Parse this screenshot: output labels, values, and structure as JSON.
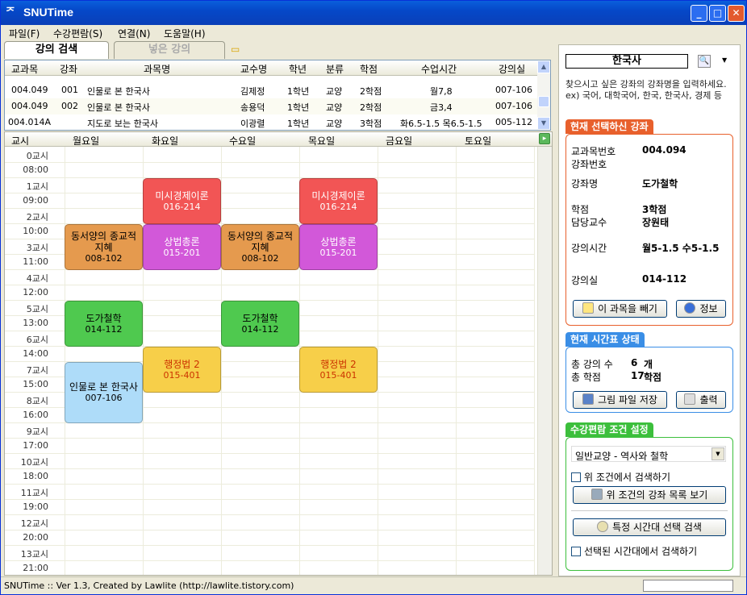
{
  "window": {
    "title": "SNUTime",
    "icon": "SNUTime-logo-icon"
  },
  "menu": [
    "파일(F)",
    "수강편람(S)",
    "연결(N)",
    "도움말(H)"
  ],
  "tabs": {
    "search": "강의 검색",
    "added": "넣은 강의"
  },
  "course_list": {
    "columns": [
      "교과목",
      "강좌",
      "과목명",
      "교수명",
      "학년",
      "분류",
      "학점",
      "수업시간",
      "강의실"
    ],
    "rows": [
      {
        "code": "004.049",
        "sec": "001",
        "name": "인물로 본 한국사",
        "prof": "김제정",
        "year": "1학년",
        "cat": "교양",
        "credit": "2학점",
        "time": "월7,8",
        "room": "007-106"
      },
      {
        "code": "004.049",
        "sec": "002",
        "name": "인물로 본 한국사",
        "prof": "송용덕",
        "year": "1학년",
        "cat": "교양",
        "credit": "2학점",
        "time": "금3,4",
        "room": "007-106"
      },
      {
        "code": "004.014A",
        "sec": "",
        "name": "지도로 보는 한국사",
        "prof": "이광렬",
        "year": "1학년",
        "cat": "교양",
        "credit": "3학점",
        "time": "화6.5-1.5 목6.5-1.5",
        "room": "005-112"
      }
    ]
  },
  "timetable": {
    "columns": [
      "교시",
      "월요일",
      "화요일",
      "수요일",
      "목요일",
      "금요일",
      "토요일"
    ],
    "periods": [
      "0교시",
      "08:00",
      "1교시",
      "09:00",
      "2교시",
      "10:00",
      "3교시",
      "11:00",
      "4교시",
      "12:00",
      "5교시",
      "13:00",
      "6교시",
      "14:00",
      "7교시",
      "15:00",
      "8교시",
      "16:00",
      "9교시",
      "17:00",
      "10교시",
      "18:00",
      "11교시",
      "19:00",
      "12교시",
      "20:00",
      "13교시",
      "21:00"
    ],
    "blocks": [
      {
        "name": "미시경제이론",
        "room": "016-214",
        "color": "#f25555",
        "text": "#ffffff"
      },
      {
        "name": "미시경제이론",
        "room": "016-214",
        "color": "#f25555",
        "text": "#ffffff"
      },
      {
        "name": "동서양의 종교적 지혜",
        "room": "008-102",
        "color": "#e59a4e",
        "text": "#000000"
      },
      {
        "name": "상법총론",
        "room": "015-201",
        "color": "#d258d9",
        "text": "#ffffff"
      },
      {
        "name": "동서양의 종교적 지혜",
        "room": "008-102",
        "color": "#e59a4e",
        "text": "#000000"
      },
      {
        "name": "상법총론",
        "room": "015-201",
        "color": "#d258d9",
        "text": "#ffffff"
      },
      {
        "name": "도가철학",
        "room": "014-112",
        "color": "#4fc94f",
        "text": "#000000"
      },
      {
        "name": "도가철학",
        "room": "014-112",
        "color": "#4fc94f",
        "text": "#000000"
      },
      {
        "name": "행정법 2",
        "room": "015-401",
        "color": "#f7cf49",
        "text": "#cc3300"
      },
      {
        "name": "행정법 2",
        "room": "015-401",
        "color": "#f7cf49",
        "text": "#cc3300"
      },
      {
        "name": "인물로 본 한국사",
        "room": "007-106",
        "color": "#aedcf9",
        "text": "#000000"
      }
    ]
  },
  "search": {
    "value": "한국사",
    "hint": "찾으시고 싶은 강좌의 강좌명을 입력하세요. ex) 국어, 대학국어, 한국, 한국사, 경제 등"
  },
  "selected": {
    "title": "현재 선택하신 강좌",
    "code_label": "교과목번호",
    "code": "004.094",
    "sec_label": "강좌번호",
    "sec": "",
    "name_label": "강좌명",
    "name": "도가철학",
    "credit_label": "학점",
    "credit": "3학점",
    "prof_label": "담당교수",
    "prof": "장원태",
    "time_label": "강의시간",
    "time": "월5-1.5 수5-1.5",
    "room_label": "강의실",
    "room": "014-112",
    "remove_btn": "이 과목을 빼기",
    "info_btn": "정보"
  },
  "status": {
    "title": "현재 시간표 상태",
    "count_label": "총 강의 수",
    "count": "6",
    "count_unit": "개",
    "credit_label": "총 학점",
    "credit": "17",
    "credit_unit": "학점",
    "save_btn": "그림 파일 저장",
    "print_btn": "출력"
  },
  "conditions": {
    "title": "수강편람 조건 설정",
    "category": "일반교양 - 역사와 철학",
    "search_in": "위 조건에서 검색하기",
    "list_btn": "위 조건의 강좌 목록 보기",
    "time_btn": "특정 시간대 선택 검색",
    "time_check": "선택된 시간대에서 검색하기"
  },
  "statusbar": "SNUTime :: Ver 1.3, Created by Lawlite (http://lawlite.tistory.com)"
}
